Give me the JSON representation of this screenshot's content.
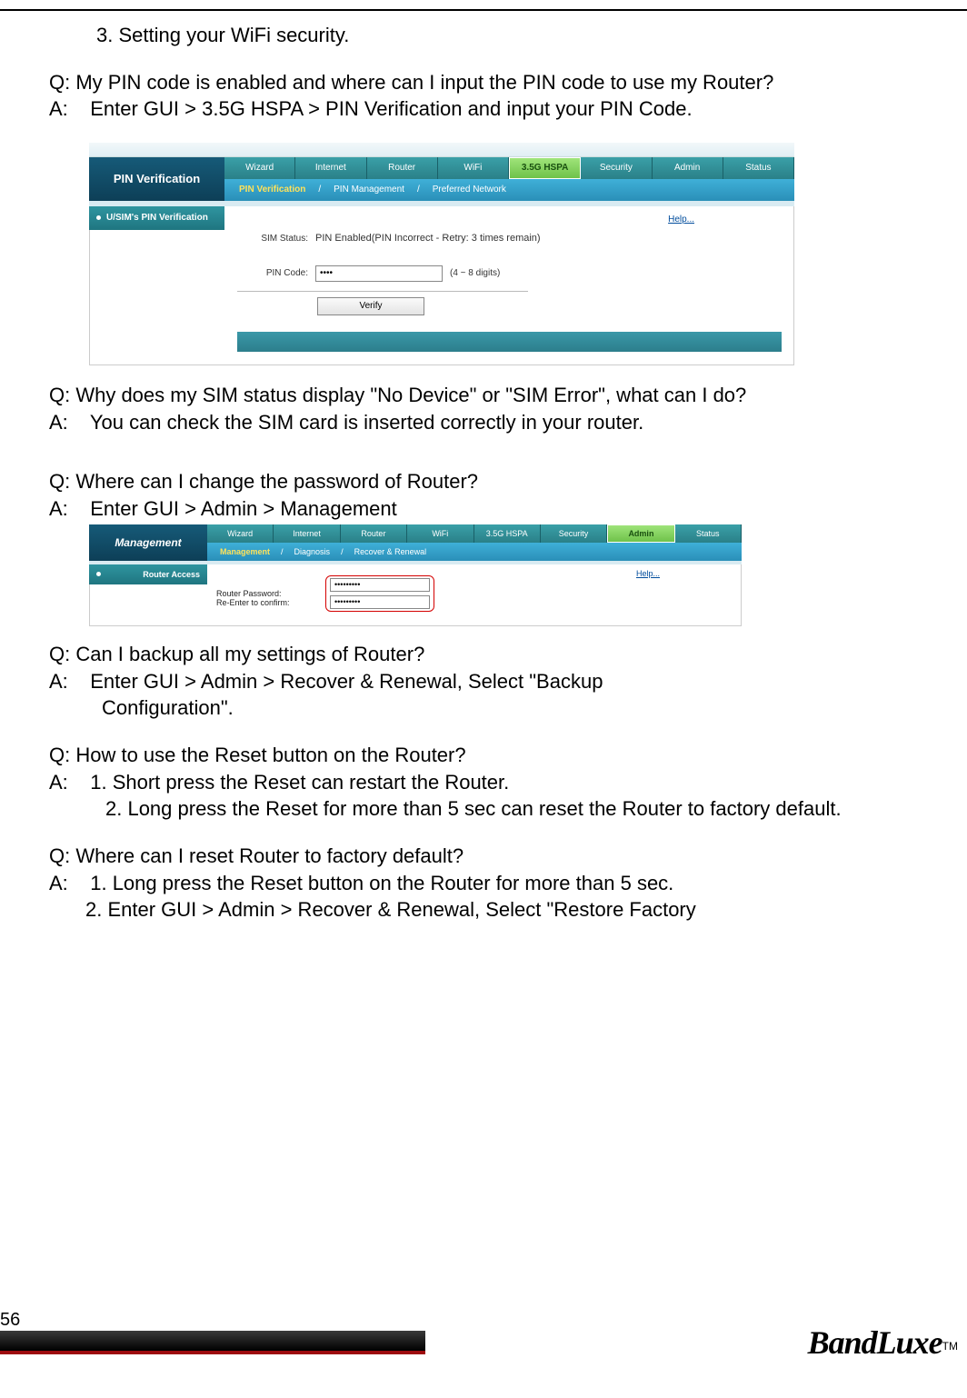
{
  "page_number": "56",
  "brand": "BandLuxe",
  "trademark": "TM",
  "text": {
    "t1": "3. Setting your WiFi security.",
    "q1": "Q: My PIN code is enabled and where can I input the PIN code to use my Router?",
    "a1": "A:    Enter GUI > 3.5G HSPA > PIN Verification and input your PIN Code.",
    "q2": "Q: Why does my SIM status display \"No Device\" or \"SIM Error\", what can I do?",
    "a2": "A:    You can check the SIM card is inserted correctly in your router.",
    "q3": "Q: Where can I change the password of Router?",
    "a3": "A:    Enter GUI > Admin > Management",
    "q4": "Q: Can I backup all my settings of Router?",
    "a4a": "A:    Enter GUI > Admin > Recover & Renewal, Select \"Backup",
    "a4b": "Configuration\".",
    "q5": "Q: How to use the Reset button on the Router?",
    "a5a": "A:    1. Short press the Reset can restart the Router.",
    "a5b": "2. Long press the Reset for more than 5 sec can reset the Router to factory default.",
    "q6": "Q: Where can I reset Router to factory default?",
    "a6a": "A:    1. Long press the Reset button on the Router for more than 5 sec.",
    "a6b": "2. Enter GUI > Admin > Recover & Renewal, Select \"Restore Factory"
  },
  "shot1": {
    "title": "PIN Verification",
    "tabs": [
      "Wizard",
      "Internet",
      "Router",
      "WiFi",
      "3.5G HSPA",
      "Security",
      "Admin",
      "Status"
    ],
    "active_tab_index": 4,
    "subtabs": [
      "PIN Verification",
      "PIN Management",
      "Preferred Network"
    ],
    "active_subtab_index": 0,
    "sep": "/",
    "sidebar_item": "U/SIM's PIN Verification",
    "help": "Help...",
    "sim_status_label": "SIM Status:",
    "sim_status_value": "PIN Enabled(PIN Incorrect - Retry: 3 times remain)",
    "pin_label": "PIN Code:",
    "pin_value": "••••",
    "pin_hint": "(4 ~ 8 digits)",
    "verify": "Verify"
  },
  "shot2": {
    "title": "Management",
    "tabs": [
      "Wizard",
      "Internet",
      "Router",
      "WiFi",
      "3.5G HSPA",
      "Security",
      "Admin",
      "Status"
    ],
    "active_tab_index": 6,
    "subtabs": [
      "Management",
      "Diagnosis",
      "Recover & Renewal"
    ],
    "active_subtab_index": 0,
    "sep": "/",
    "sidebar_item": "Router Access",
    "help": "Help...",
    "pw_label": "Router Password:",
    "pw2_label": "Re-Enter to confirm:",
    "pw_value": "•••••••••"
  }
}
